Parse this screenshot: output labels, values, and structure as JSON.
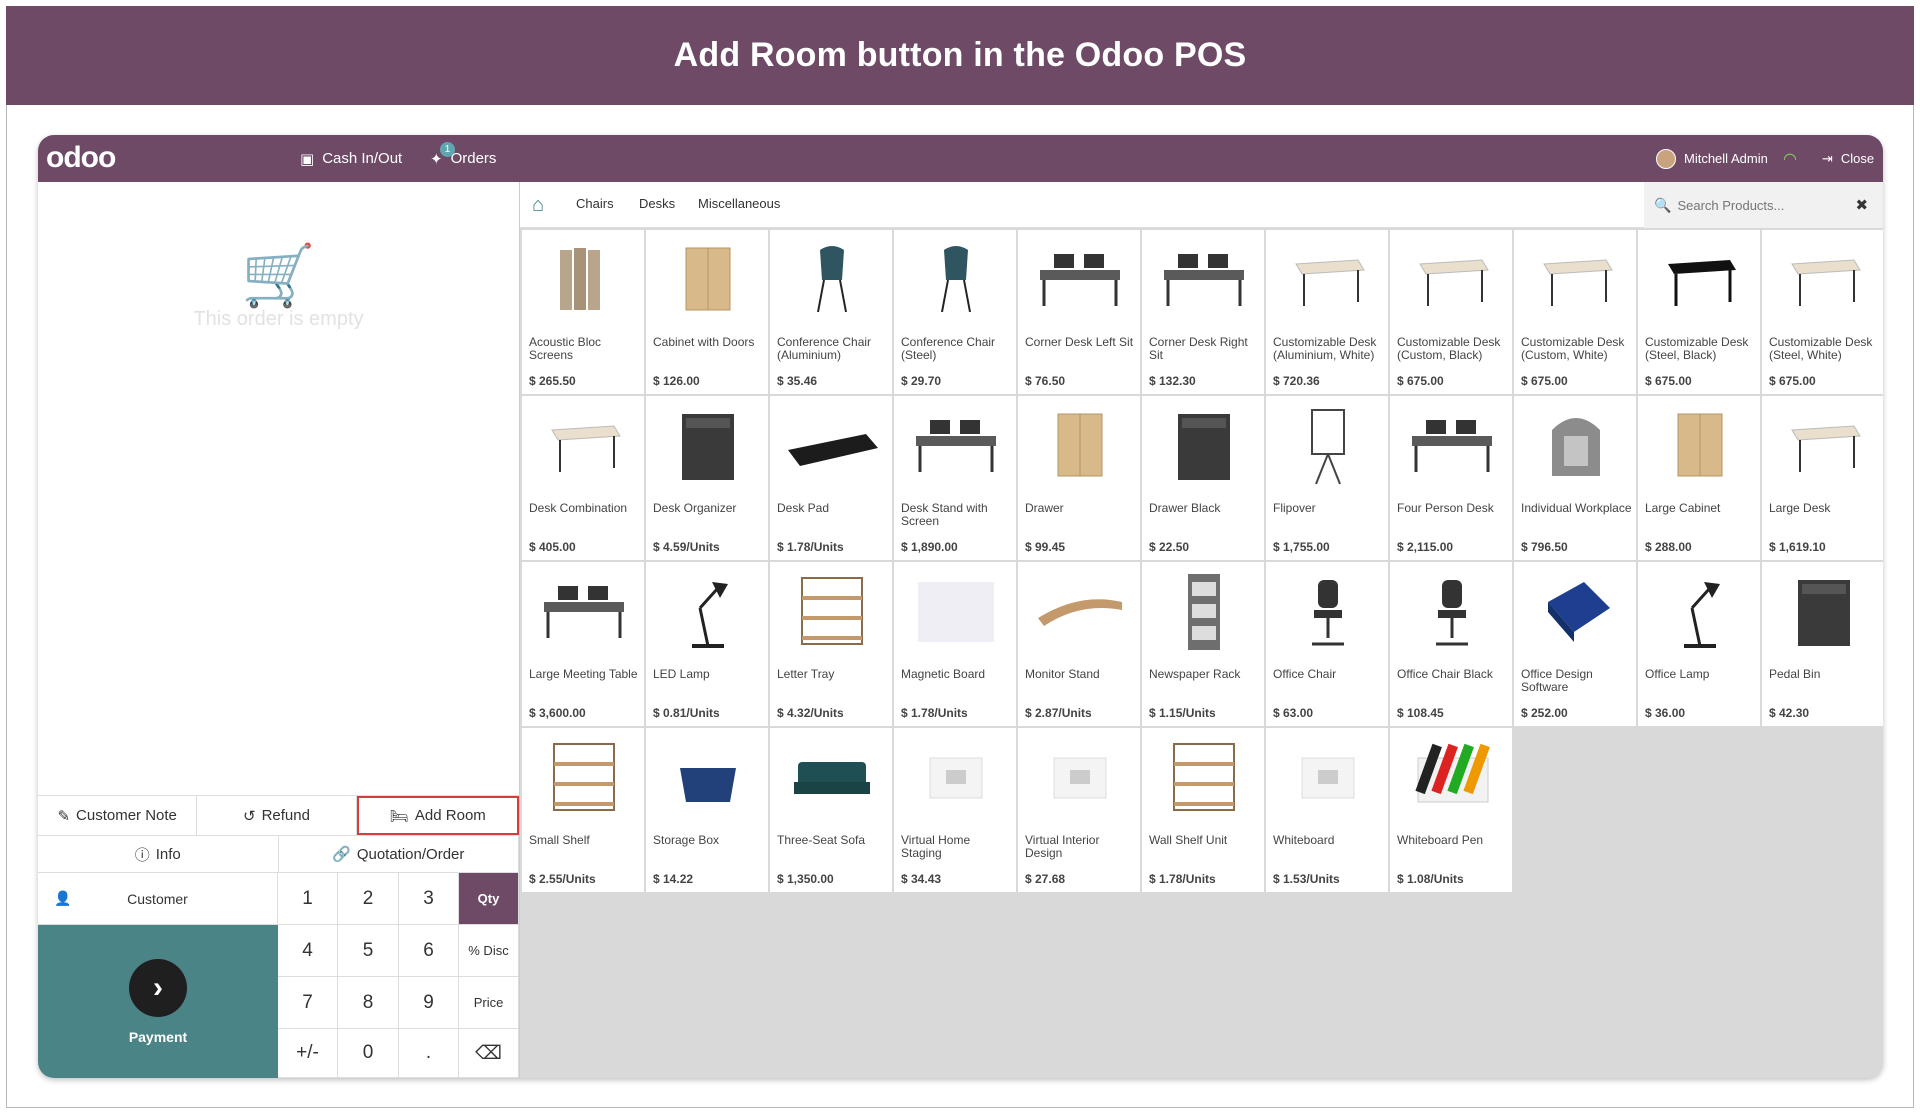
{
  "banner": {
    "title": "Add Room button in the Odoo POS"
  },
  "topbar": {
    "logo": "odoo",
    "cash": "Cash In/Out",
    "orders": "Orders",
    "orders_badge": "1",
    "user": "Mitchell Admin",
    "close": "Close"
  },
  "order": {
    "empty_text": "This order is empty"
  },
  "controls": {
    "customer_note": "Customer Note",
    "refund": "Refund",
    "add_room": "Add Room",
    "info": "Info",
    "quotation": "Quotation/Order"
  },
  "numpad": {
    "customer": "Customer",
    "payment": "Payment",
    "keys": [
      "1",
      "2",
      "3",
      "Qty",
      "4",
      "5",
      "6",
      "% Disc",
      "7",
      "8",
      "9",
      "Price",
      "+/-",
      "0",
      ".",
      "⌫"
    ]
  },
  "categories": {
    "c1": "Chairs",
    "c2": "Desks",
    "c3": "Miscellaneous"
  },
  "search": {
    "placeholder": "Search Products..."
  },
  "colors": {
    "brand": "#6e4a66",
    "payment": "#4b8486",
    "highlight": "#d73b3b"
  },
  "products": [
    {
      "name": "Acoustic Bloc Screens",
      "price": "$ 265.50",
      "icon": "panel"
    },
    {
      "name": "Cabinet with Doors",
      "price": "$ 126.00",
      "icon": "cabinet"
    },
    {
      "name": "Conference Chair (Aluminium)",
      "price": "$ 35.46",
      "icon": "chair"
    },
    {
      "name": "Conference Chair (Steel)",
      "price": "$ 29.70",
      "icon": "chair"
    },
    {
      "name": "Corner Desk Left Sit",
      "price": "$ 76.50",
      "icon": "desk"
    },
    {
      "name": "Corner Desk Right Sit",
      "price": "$ 132.30",
      "icon": "desk"
    },
    {
      "name": "Customizable Desk (Aluminium, White)",
      "price": "$ 720.36",
      "icon": "table"
    },
    {
      "name": "Customizable Desk (Custom, Black)",
      "price": "$ 675.00",
      "icon": "table"
    },
    {
      "name": "Customizable Desk (Custom, White)",
      "price": "$ 675.00",
      "icon": "table"
    },
    {
      "name": "Customizable Desk (Steel, Black)",
      "price": "$ 675.00",
      "icon": "tableblack"
    },
    {
      "name": "Customizable Desk (Steel, White)",
      "price": "$ 675.00",
      "icon": "table"
    },
    {
      "name": "Desk Combination",
      "price": "$ 405.00",
      "icon": "table"
    },
    {
      "name": "Desk Organizer",
      "price": "$ 4.59/Units",
      "icon": "box"
    },
    {
      "name": "Desk Pad",
      "price": "$ 1.78/Units",
      "icon": "pad"
    },
    {
      "name": "Desk Stand with Screen",
      "price": "$ 1,890.00",
      "icon": "desk"
    },
    {
      "name": "Drawer",
      "price": "$ 99.45",
      "icon": "cabinet"
    },
    {
      "name": "Drawer Black",
      "price": "$ 22.50",
      "icon": "box"
    },
    {
      "name": "Flipover",
      "price": "$ 1,755.00",
      "icon": "board"
    },
    {
      "name": "Four Person Desk",
      "price": "$ 2,115.00",
      "icon": "desk"
    },
    {
      "name": "Individual Workplace",
      "price": "$ 796.50",
      "icon": "pod"
    },
    {
      "name": "Large Cabinet",
      "price": "$ 288.00",
      "icon": "cabinet"
    },
    {
      "name": "Large Desk",
      "price": "$ 1,619.10",
      "icon": "table"
    },
    {
      "name": "Large Meeting Table",
      "price": "$ 3,600.00",
      "icon": "desk"
    },
    {
      "name": "LED Lamp",
      "price": "$ 0.81/Units",
      "icon": "lamp"
    },
    {
      "name": "Letter Tray",
      "price": "$ 4.32/Units",
      "icon": "shelf"
    },
    {
      "name": "Magnetic Board",
      "price": "$ 1.78/Units",
      "icon": "blank"
    },
    {
      "name": "Monitor Stand",
      "price": "$ 2.87/Units",
      "icon": "stand"
    },
    {
      "name": "Newspaper Rack",
      "price": "$ 1.15/Units",
      "icon": "rack"
    },
    {
      "name": "Office Chair",
      "price": "$ 63.00",
      "icon": "officechair"
    },
    {
      "name": "Office Chair Black",
      "price": "$ 108.45",
      "icon": "officechair"
    },
    {
      "name": "Office Design Software",
      "price": "$ 252.00",
      "icon": "software"
    },
    {
      "name": "Office Lamp",
      "price": "$ 36.00",
      "icon": "lamp"
    },
    {
      "name": "Pedal Bin",
      "price": "$ 42.30",
      "icon": "box"
    },
    {
      "name": "Small Shelf",
      "price": "$ 2.55/Units",
      "icon": "shelf"
    },
    {
      "name": "Storage Box",
      "price": "$ 14.22",
      "icon": "storage"
    },
    {
      "name": "Three-Seat Sofa",
      "price": "$ 1,350.00",
      "icon": "sofa"
    },
    {
      "name": "Virtual Home Staging",
      "price": "$ 34.43",
      "icon": "virtual"
    },
    {
      "name": "Virtual Interior Design",
      "price": "$ 27.68",
      "icon": "virtual"
    },
    {
      "name": "Wall Shelf Unit",
      "price": "$ 1.78/Units",
      "icon": "shelf"
    },
    {
      "name": "Whiteboard",
      "price": "$ 1.53/Units",
      "icon": "virtual"
    },
    {
      "name": "Whiteboard Pen",
      "price": "$ 1.08/Units",
      "icon": "pens"
    }
  ]
}
